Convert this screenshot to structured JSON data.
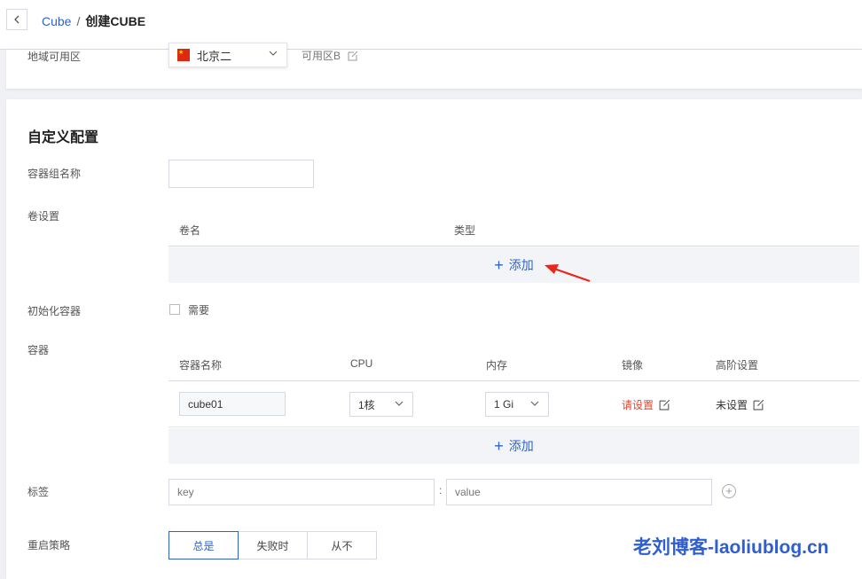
{
  "header": {
    "breadcrumb_root": "Cube",
    "breadcrumb_sep": "/",
    "breadcrumb_current": "创建CUBE"
  },
  "region": {
    "label": "地域可用区",
    "selected": "北京二",
    "zone": "可用区B"
  },
  "form": {
    "section_title": "自定义配置",
    "group_name_label": "容器组名称",
    "group_name_value": "",
    "volume_label": "卷设置",
    "volume_columns": [
      "卷名",
      "类型"
    ],
    "volume_add": "添加",
    "init_label": "初始化容器",
    "init_checkbox_label": "需要",
    "container_label": "容器",
    "container_columns": [
      "容器名称",
      "CPU",
      "内存",
      "镜像",
      "高阶设置"
    ],
    "container_row": {
      "name": "cube01",
      "cpu": "1核",
      "memory": "1 Gi",
      "image": "请设置",
      "advanced": "未设置"
    },
    "container_add": "添加",
    "tag_label": "标签",
    "tag_key_placeholder": "key",
    "tag_sep": ":",
    "tag_value_placeholder": "value",
    "restart_label": "重启策略",
    "restart_options": [
      "总是",
      "失败时",
      "从不"
    ],
    "restart_selected": "总是"
  },
  "watermark": "老刘博客-laoliublog.cn",
  "colors": {
    "link": "#2f64c7",
    "warning": "#e0452f",
    "arrow": "#e8281c"
  }
}
